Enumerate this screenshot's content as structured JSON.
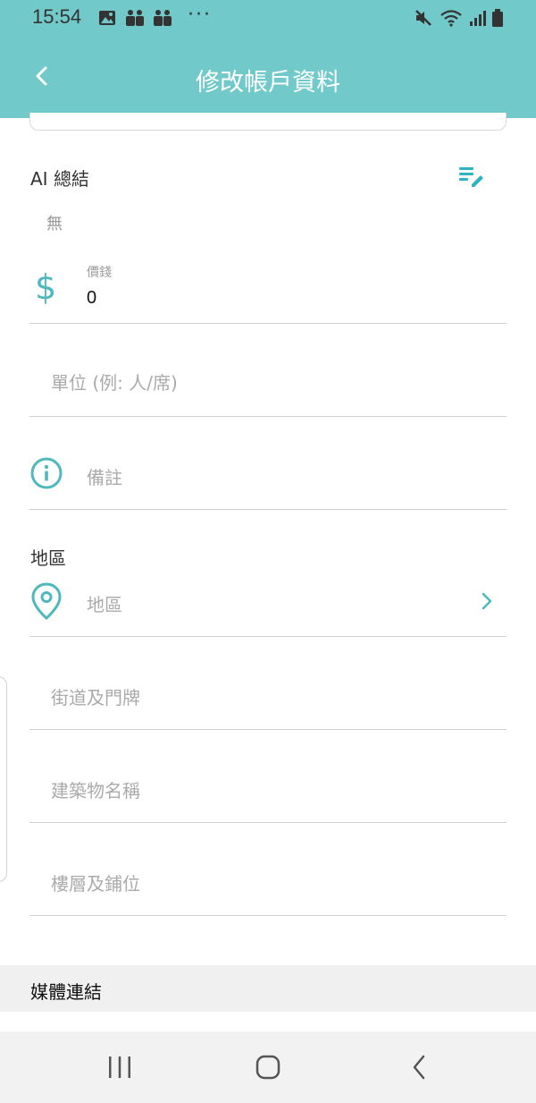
{
  "status_bar": {
    "time": "15:54",
    "more_indicator": "···",
    "icons": [
      "image-icon",
      "teams-icon",
      "teams-icon",
      "mute-icon",
      "wifi-icon",
      "signal-icon",
      "battery-icon"
    ]
  },
  "header": {
    "title": "修改帳戶資料",
    "back_icon": "chevron-left-icon",
    "background_color": "#72c9c9"
  },
  "ai_summary": {
    "label": "AI 總結",
    "value": "無",
    "edit_icon": "edit-notes-icon"
  },
  "price_field": {
    "label": "價錢",
    "value": "0",
    "icon": "dollar-icon"
  },
  "unit_field": {
    "placeholder": "單位 (例: 人/席)"
  },
  "remark_field": {
    "placeholder": "備註",
    "icon": "info-icon"
  },
  "region_section": {
    "label": "地區",
    "placeholder": "地區",
    "icon": "location-pin-icon",
    "chevron_icon": "chevron-right-icon"
  },
  "street_field": {
    "placeholder": "街道及門牌"
  },
  "building_field": {
    "placeholder": "建築物名稱"
  },
  "floor_field": {
    "placeholder": "樓層及鋪位"
  },
  "media_section": {
    "label": "媒體連結"
  },
  "nav_bar": {
    "icons": [
      "recent-apps-icon",
      "home-icon",
      "back-icon"
    ]
  },
  "colors": {
    "accent": "#72c9c9",
    "icon_teal": "#2fb3c1",
    "placeholder_gray": "#aaaaaa",
    "divider": "#d0d0d0"
  }
}
